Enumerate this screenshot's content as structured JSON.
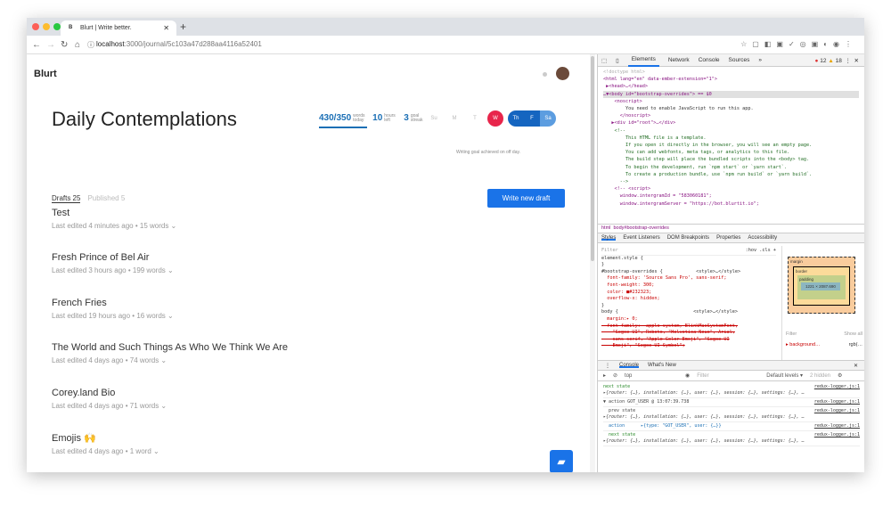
{
  "browser": {
    "tab_title": "Blurt | Write better.",
    "tab_favicon": "B",
    "url_host": "localhost",
    "url_path": ":3000/journal/5c103a47d288aa4116a52401"
  },
  "app": {
    "logo": "Blurt",
    "page_title": "Daily Contemplations",
    "stats": [
      {
        "value": "430/350",
        "unit": "words today"
      },
      {
        "value": "10",
        "unit": "hours left"
      },
      {
        "value": "3",
        "unit": "goal streak"
      }
    ],
    "days": [
      "Su",
      "M",
      "T",
      "W",
      "Th",
      "F",
      "Sa"
    ],
    "goal_note": "Writing goal achieved on off day.",
    "tabs": [
      {
        "label": "Drafts 25"
      },
      {
        "label": "Published 5"
      }
    ],
    "new_draft": "Write new draft",
    "drafts": [
      {
        "title": "Test",
        "meta": "Last edited 4 minutes ago • 15 words ⌄"
      },
      {
        "title": "Fresh Prince of Bel Air",
        "meta": "Last edited 3 hours ago • 199 words ⌄"
      },
      {
        "title": "French Fries",
        "meta": "Last edited 19 hours ago • 16 words ⌄"
      },
      {
        "title": "The World and Such Things As Who We Think We Are",
        "meta": "Last edited 4 days ago • 74 words ⌄"
      },
      {
        "title": "Corey.land Bio",
        "meta": "Last edited 4 days ago • 71 words ⌄"
      },
      {
        "title": "Emojis 🙌",
        "meta": "Last edited 4 days ago • 1 word ⌄"
      }
    ]
  },
  "devtools": {
    "tabs": [
      "Elements",
      "Network",
      "Console",
      "Sources",
      "»"
    ],
    "errors": "12",
    "warnings": "18",
    "elements": [
      "<!doctype html>",
      "<html lang=\"en\" data-ember-extension=\"1\">",
      " ▶<head>…</head>",
      "…▼<body id=\"bootstrap-overrides\"> == $0",
      "    <noscript>",
      "        You need to enable JavaScript to run this app.",
      "      </noscript>",
      "   ▶<div id=\"root\">…</div>",
      "    <!--",
      "        This HTML file is a template.",
      "        If you open it directly in the browser, you will see an empty page.",
      "",
      "        You can add webfonts, meta tags, or analytics to this file.",
      "        The build step will place the bundled scripts into the <body> tag.",
      "",
      "        To begin the development, run `npm start` or `yarn start`.",
      "        To create a production bundle, use `npm run build` or `yarn build`.",
      "      -->",
      "    <!-- <script>",
      "      window.intergramId = \"583060181\";",
      "      window.intergramServer = \"https://bot.blurtit.io\";"
    ],
    "breadcrumb": [
      "html",
      "body#bootstrap-overrides"
    ],
    "style_tabs": [
      "Styles",
      "Event Listeners",
      "DOM Breakpoints",
      "Properties",
      "Accessibility"
    ],
    "filter": "Filter",
    "hov": ":hov .cls +",
    "styles": [
      "element.style {",
      "}",
      "#bootstrap-overrides {            <style>…</style>",
      "  font-family: 'Source Sans Pro', sans-serif;",
      "  font-weight: 300;",
      "  color: ■#232323;",
      "  overflow-x: hidden;",
      "}",
      "body {                           <style>…</style>",
      "  margin:▸ 0;",
      "  font-family: -apple-system, BlinkMacSystemFont,",
      "    \"Segoe UI\", Roboto, \"Helvetica Neue\", Arial,",
      "    sans-serif, \"Apple Color Emoji\", \"Segoe UI",
      "    Emoji\", \"Segoe UI Symbol\";"
    ],
    "boxmodel": {
      "margin": "margin",
      "border": "border",
      "padding": "padding",
      "content": "1221 × 2087.690",
      "filter": "Filter",
      "show_all": "Show all",
      "prop": "▸ background…",
      "val": "rgb(…"
    },
    "console_tabs": [
      "Console",
      "What's New"
    ],
    "console_context": "top",
    "console_filter": "Filter",
    "levels": "Default levels ▾",
    "hidden": "2 hidden",
    "logs": [
      {
        "label": "next state",
        "text": "▸{router: {…}, installation: {…}, user: {…}, session: {…}, settings: {…}, …",
        "src": "redux-logger.js:1",
        "cls": "green"
      },
      {
        "label": "▼ action GOT_USER @ 13:07:39.738",
        "text": "",
        "src": "redux-logger.js:1",
        "cls": ""
      },
      {
        "label": "  prev state",
        "text": "▸{router: {…}, installation: {…}, user: {…}, session: {…}, settings: {…}, …",
        "src": "redux-logger.js:1",
        "cls": ""
      },
      {
        "label": "  action      ▸{type: \"GOT_USER\", user: {…}}",
        "text": "",
        "src": "redux-logger.js:1",
        "cls": "blue"
      },
      {
        "label": "  next state",
        "text": "▸{router: {…}, installation: {…}, user: {…}, session: {…}, settings: {…}, …",
        "src": "redux-logger.js:1",
        "cls": "green"
      }
    ]
  }
}
